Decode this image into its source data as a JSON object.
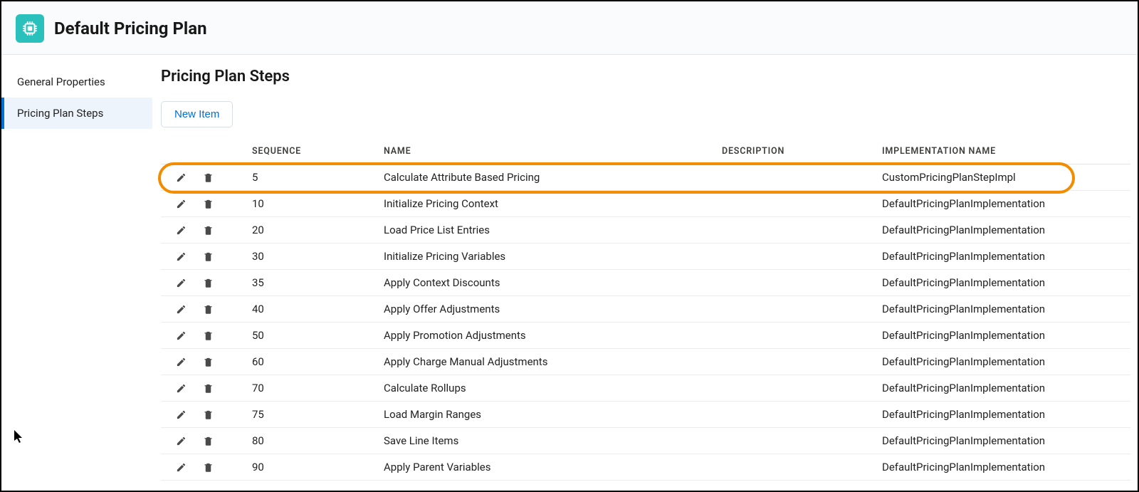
{
  "header": {
    "title": "Default Pricing Plan"
  },
  "sidebar": {
    "items": [
      {
        "label": "General Properties",
        "active": false
      },
      {
        "label": "Pricing Plan Steps",
        "active": true
      }
    ]
  },
  "main": {
    "title": "Pricing Plan Steps",
    "new_item_label": "New Item",
    "columns": {
      "sequence": "SEQUENCE",
      "name": "NAME",
      "description": "DESCRIPTION",
      "implementation": "IMPLEMENTATION NAME"
    },
    "rows": [
      {
        "sequence": "5",
        "name": "Calculate Attribute Based Pricing",
        "description": "",
        "implementation": "CustomPricingPlanStepImpl",
        "highlighted": true
      },
      {
        "sequence": "10",
        "name": "Initialize Pricing Context",
        "description": "",
        "implementation": "DefaultPricingPlanImplementation"
      },
      {
        "sequence": "20",
        "name": "Load Price List Entries",
        "description": "",
        "implementation": "DefaultPricingPlanImplementation"
      },
      {
        "sequence": "30",
        "name": "Initialize Pricing Variables",
        "description": "",
        "implementation": "DefaultPricingPlanImplementation"
      },
      {
        "sequence": "35",
        "name": "Apply Context Discounts",
        "description": "",
        "implementation": "DefaultPricingPlanImplementation"
      },
      {
        "sequence": "40",
        "name": "Apply Offer Adjustments",
        "description": "",
        "implementation": "DefaultPricingPlanImplementation"
      },
      {
        "sequence": "50",
        "name": "Apply Promotion Adjustments",
        "description": "",
        "implementation": "DefaultPricingPlanImplementation"
      },
      {
        "sequence": "60",
        "name": "Apply Charge Manual Adjustments",
        "description": "",
        "implementation": "DefaultPricingPlanImplementation"
      },
      {
        "sequence": "70",
        "name": "Calculate Rollups",
        "description": "",
        "implementation": "DefaultPricingPlanImplementation"
      },
      {
        "sequence": "75",
        "name": "Load Margin Ranges",
        "description": "",
        "implementation": "DefaultPricingPlanImplementation"
      },
      {
        "sequence": "80",
        "name": "Save Line Items",
        "description": "",
        "implementation": "DefaultPricingPlanImplementation"
      },
      {
        "sequence": "90",
        "name": "Apply Parent Variables",
        "description": "",
        "implementation": "DefaultPricingPlanImplementation"
      }
    ]
  }
}
